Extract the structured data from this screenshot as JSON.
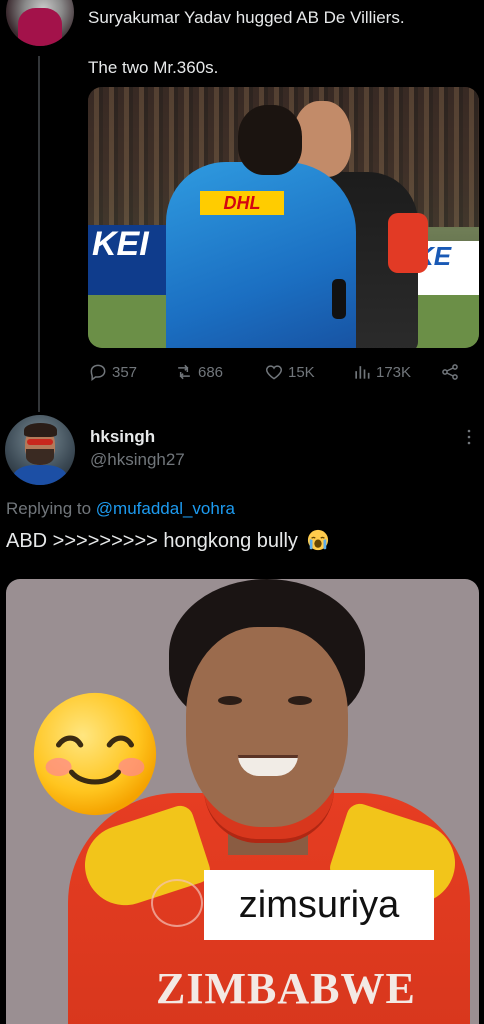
{
  "tweet1": {
    "text_line1": "Suryakumar Yadav hugged AB De Villiers.",
    "text_line2": "The two Mr.360s.",
    "media": {
      "board_left_text": "KEI",
      "board_right_text": "KE",
      "sponsor_text": "DHL"
    },
    "actions": {
      "replies": "357",
      "reposts": "686",
      "likes": "15K",
      "views": "173K"
    }
  },
  "tweet2": {
    "display_name": "hksingh",
    "handle": "@hksingh27",
    "replying_prefix": "Replying to ",
    "replying_mention": "@mufaddal_vohra",
    "text": "ABD >>>>>>>>> hongkong bully",
    "media": {
      "caption": "zimsuriya",
      "jersey_text": "ZIMBABWE"
    }
  },
  "icons": [
    "reply-icon",
    "repost-icon",
    "like-icon",
    "views-icon",
    "share-icon",
    "more-icon",
    "crying-emoji-icon",
    "smiling-emoji-icon"
  ],
  "colors": {
    "background": "#000000",
    "text": "#e7e9ea",
    "muted": "#71767b",
    "link": "#1d9bf0"
  }
}
